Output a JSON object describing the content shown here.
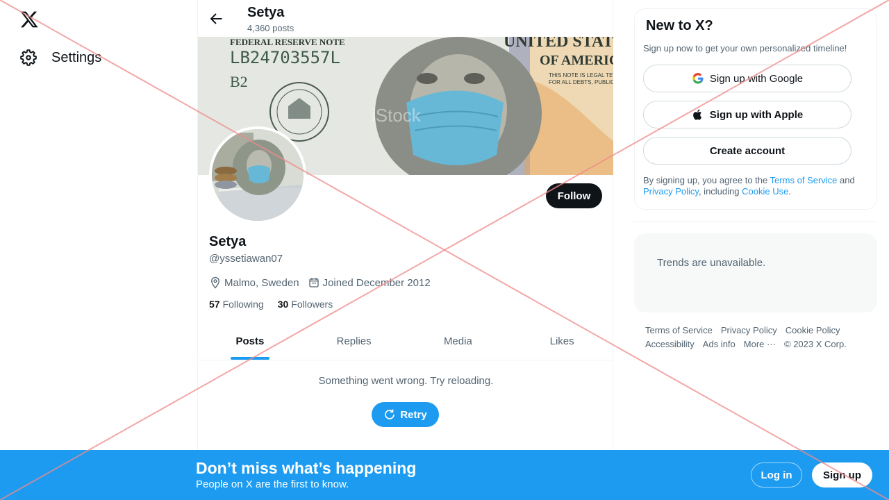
{
  "nav": {
    "settings_label": "Settings"
  },
  "header": {
    "name": "Setya",
    "posts": "4,360 posts"
  },
  "banner": {
    "serial": "LB24703557L",
    "reserve": "FEDERAL RESERVE NOTE",
    "district": "B2",
    "united": "UNITED STATES",
    "america": "OF AMERICA",
    "legal1": "THIS NOTE IS LEGAL TENDER",
    "legal2": "FOR ALL DEBTS, PUBLIC AND PRIVATE",
    "watermark": "iStock"
  },
  "profile": {
    "follow_label": "Follow",
    "name": "Setya",
    "handle": "@yssetiawan07",
    "location": "Malmo, Sweden",
    "joined": "Joined December 2012",
    "following_count": "57",
    "following_label": "Following",
    "followers_count": "30",
    "followers_label": "Followers"
  },
  "tabs": [
    {
      "label": "Posts",
      "active": true
    },
    {
      "label": "Replies",
      "active": false
    },
    {
      "label": "Media",
      "active": false
    },
    {
      "label": "Likes",
      "active": false
    }
  ],
  "feed": {
    "error": "Something went wrong. Try reloading.",
    "retry_label": "Retry"
  },
  "signup_card": {
    "title": "New to X?",
    "subtitle": "Sign up now to get your own personalized timeline!",
    "google_label": "Sign up with Google",
    "apple_label": "Sign up with Apple",
    "create_label": "Create account",
    "legal_prefix": "By signing up, you agree to the ",
    "terms_link": "Terms of Service",
    "legal_and": " and ",
    "privacy_link": "Privacy Policy",
    "legal_including": ", including ",
    "cookie_link": "Cookie Use",
    "legal_end": "."
  },
  "trends": {
    "message": "Trends are unavailable."
  },
  "footer": {
    "terms": "Terms of Service",
    "privacy": "Privacy Policy",
    "cookie": "Cookie Policy",
    "accessibility": "Accessibility",
    "ads": "Ads info",
    "more": "More ···",
    "copyright": "© 2023 X Corp."
  },
  "bottom_bar": {
    "title": "Don’t miss what’s happening",
    "subtitle": "People on X are the first to know.",
    "login_label": "Log in",
    "signup_label": "Sign up"
  },
  "colors": {
    "accent": "#1d9bf0",
    "text_primary": "#0f1419",
    "text_secondary": "#536471",
    "overlay_x": "#f08a8a"
  },
  "icons": {
    "logo": "x-logo-icon",
    "settings": "gear-icon",
    "back": "arrow-left-icon",
    "location": "location-pin-icon",
    "calendar": "calendar-icon",
    "retry": "refresh-icon",
    "google": "google-icon",
    "apple": "apple-icon"
  }
}
